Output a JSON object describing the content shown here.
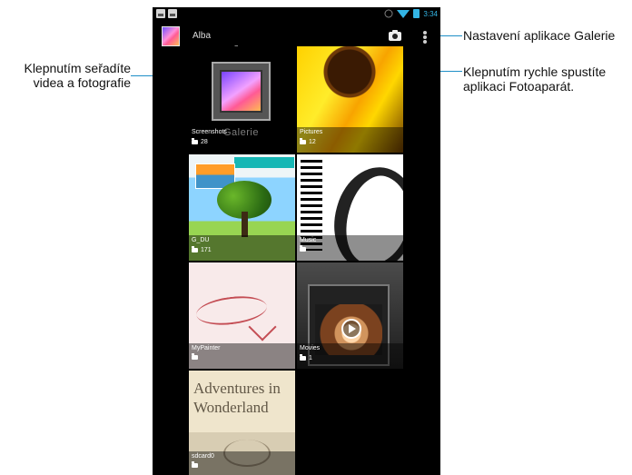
{
  "callouts": {
    "left": "Klepnutím seřadíte videa a fotografie",
    "settings": "Nastavení aplikace Galerie",
    "camera": "Klepnutím rychle spustíte aplikaci Fotoaparát."
  },
  "status_bar": {
    "time": "3:34",
    "icons": [
      "gallery-icon",
      "gallery-icon",
      "screen-rotation-icon",
      "wifi-icon",
      "battery-icon"
    ]
  },
  "action_bar": {
    "title": "Alba",
    "camera_icon": "camera-icon",
    "menu_icon": "overflow-menu-icon"
  },
  "albums": [
    {
      "name": "Screenshots",
      "count": "28",
      "caption": "Galerie"
    },
    {
      "name": "Pictures",
      "count": "12"
    },
    {
      "name": "G_DU",
      "count": "171"
    },
    {
      "name": "Music",
      "count": ""
    },
    {
      "name": "MyPainter",
      "count": ""
    },
    {
      "name": "Movies",
      "count": "1"
    },
    {
      "name": "sdcard0",
      "count": "",
      "book_title": "Adventures in Wonderland"
    }
  ],
  "colors": {
    "callout_line": "#1e8fc7",
    "status_blue": "#33b5e5",
    "screen_bg": "#000000"
  }
}
